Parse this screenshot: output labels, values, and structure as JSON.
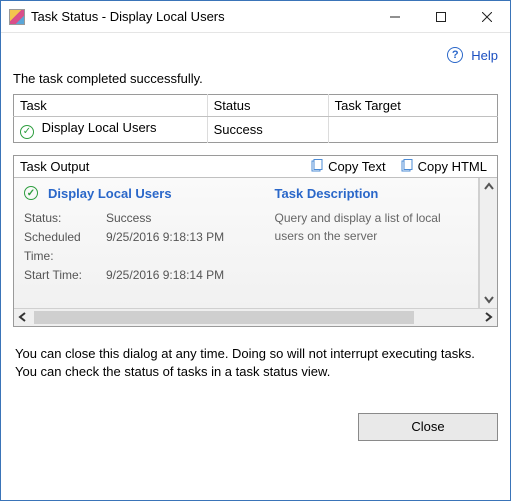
{
  "window": {
    "title": "Task Status - Display Local Users"
  },
  "help": {
    "label": "Help"
  },
  "summary": "The task completed successfully.",
  "table": {
    "headers": {
      "task": "Task",
      "status": "Status",
      "target": "Task Target"
    },
    "rows": [
      {
        "task": "Display Local Users",
        "status": "Success",
        "target": ""
      }
    ]
  },
  "output": {
    "label": "Task Output",
    "copy_text": "Copy Text",
    "copy_html": "Copy HTML",
    "title": "Display Local Users",
    "desc_label": "Task Description",
    "description": "Query and display a list of local users on the server",
    "fields": {
      "status_label": "Status:",
      "status_value": "Success",
      "scheduled_label": "Scheduled Time:",
      "scheduled_value": "9/25/2016 9:18:13 PM",
      "start_label": "Start Time:",
      "start_value": "9/25/2016 9:18:14 PM"
    }
  },
  "hint": "You can close this dialog at any time. Doing so will not interrupt executing tasks. You can check the status of tasks in a task status view.",
  "buttons": {
    "close": "Close"
  }
}
